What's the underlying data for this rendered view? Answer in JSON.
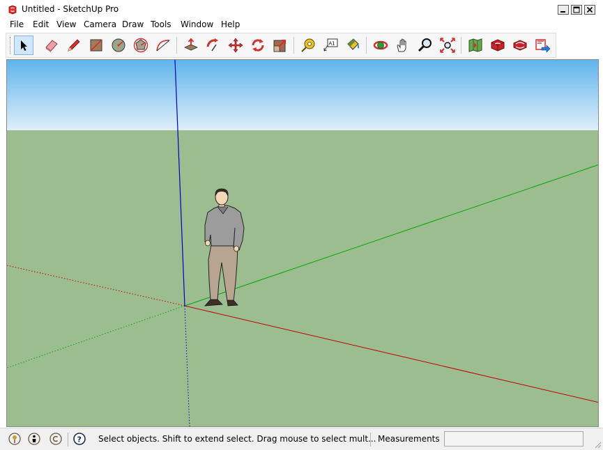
{
  "window": {
    "title": "Untitled - SketchUp Pro",
    "controls": {
      "minimize": "_",
      "maximize": "□",
      "close": "X"
    }
  },
  "menu": [
    "File",
    "Edit",
    "View",
    "Camera",
    "Draw",
    "Tools",
    "Window",
    "Help"
  ],
  "toolbar": {
    "tools": [
      {
        "name": "select-tool",
        "icon": "arrow-cursor-icon",
        "active": true
      },
      {
        "name": "eraser-tool",
        "icon": "eraser-icon"
      },
      {
        "name": "line-tool",
        "icon": "pencil-icon"
      },
      {
        "name": "rectangle-tool",
        "icon": "rectangle-icon"
      },
      {
        "name": "circle-tool",
        "icon": "circle-icon"
      },
      {
        "name": "polygon-tool",
        "icon": "polygon-icon"
      },
      {
        "name": "arc-tool",
        "icon": "arc-icon"
      },
      {
        "name": "push-pull-tool",
        "icon": "push-pull-icon"
      },
      {
        "name": "follow-me-tool",
        "icon": "follow-me-icon"
      },
      {
        "name": "move-tool",
        "icon": "move-icon"
      },
      {
        "name": "rotate-tool",
        "icon": "rotate-icon"
      },
      {
        "name": "scale-tool",
        "icon": "scale-icon"
      },
      {
        "name": "tape-measure-tool",
        "icon": "tape-measure-icon"
      },
      {
        "name": "text-tool",
        "icon": "text-icon",
        "label": "A1"
      },
      {
        "name": "paint-bucket-tool",
        "icon": "paint-bucket-icon"
      },
      {
        "name": "orbit-tool",
        "icon": "orbit-icon"
      },
      {
        "name": "pan-tool",
        "icon": "hand-icon"
      },
      {
        "name": "zoom-tool",
        "icon": "magnifier-icon"
      },
      {
        "name": "zoom-extents-tool",
        "icon": "zoom-extents-icon"
      },
      {
        "name": "3d-warehouse-tool",
        "icon": "warehouse-map-icon"
      },
      {
        "name": "extension-warehouse-tool",
        "icon": "extension-warehouse-icon"
      },
      {
        "name": "share-model-tool",
        "icon": "share-model-icon"
      },
      {
        "name": "layout-tool",
        "icon": "layout-send-icon"
      }
    ]
  },
  "colors": {
    "sky_top": "#5fb4ec",
    "sky_bottom": "#e1effa",
    "ground": "#9cbd8f",
    "axis_red": "#c00000",
    "axis_green": "#00a800",
    "axis_blue": "#0000c0",
    "tool_active_bg": "#cfe6fb"
  },
  "status": {
    "icons": [
      "geo-location-icon",
      "credits-icon",
      "copyright-icon",
      "help-icon"
    ],
    "text": "Select objects. Shift to extend select. Drag mouse to select mult...",
    "measurements_label": "Measurements",
    "measurements_value": ""
  }
}
